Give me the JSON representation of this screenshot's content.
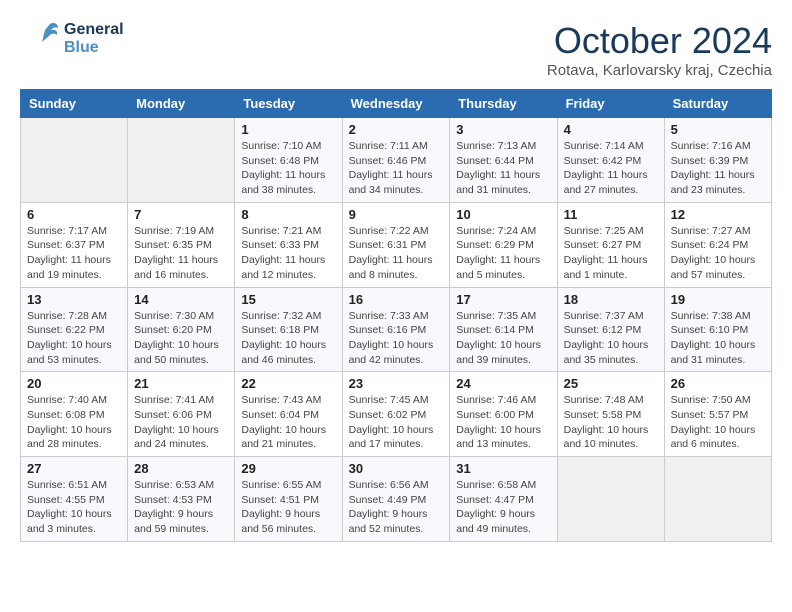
{
  "header": {
    "logo_line1": "General",
    "logo_line2": "Blue",
    "month": "October 2024",
    "location": "Rotava, Karlovarsky kraj, Czechia"
  },
  "days_of_week": [
    "Sunday",
    "Monday",
    "Tuesday",
    "Wednesday",
    "Thursday",
    "Friday",
    "Saturday"
  ],
  "weeks": [
    [
      {
        "day": "",
        "info": ""
      },
      {
        "day": "",
        "info": ""
      },
      {
        "day": "1",
        "info": "Sunrise: 7:10 AM\nSunset: 6:48 PM\nDaylight: 11 hours and 38 minutes."
      },
      {
        "day": "2",
        "info": "Sunrise: 7:11 AM\nSunset: 6:46 PM\nDaylight: 11 hours and 34 minutes."
      },
      {
        "day": "3",
        "info": "Sunrise: 7:13 AM\nSunset: 6:44 PM\nDaylight: 11 hours and 31 minutes."
      },
      {
        "day": "4",
        "info": "Sunrise: 7:14 AM\nSunset: 6:42 PM\nDaylight: 11 hours and 27 minutes."
      },
      {
        "day": "5",
        "info": "Sunrise: 7:16 AM\nSunset: 6:39 PM\nDaylight: 11 hours and 23 minutes."
      }
    ],
    [
      {
        "day": "6",
        "info": "Sunrise: 7:17 AM\nSunset: 6:37 PM\nDaylight: 11 hours and 19 minutes."
      },
      {
        "day": "7",
        "info": "Sunrise: 7:19 AM\nSunset: 6:35 PM\nDaylight: 11 hours and 16 minutes."
      },
      {
        "day": "8",
        "info": "Sunrise: 7:21 AM\nSunset: 6:33 PM\nDaylight: 11 hours and 12 minutes."
      },
      {
        "day": "9",
        "info": "Sunrise: 7:22 AM\nSunset: 6:31 PM\nDaylight: 11 hours and 8 minutes."
      },
      {
        "day": "10",
        "info": "Sunrise: 7:24 AM\nSunset: 6:29 PM\nDaylight: 11 hours and 5 minutes."
      },
      {
        "day": "11",
        "info": "Sunrise: 7:25 AM\nSunset: 6:27 PM\nDaylight: 11 hours and 1 minute."
      },
      {
        "day": "12",
        "info": "Sunrise: 7:27 AM\nSunset: 6:24 PM\nDaylight: 10 hours and 57 minutes."
      }
    ],
    [
      {
        "day": "13",
        "info": "Sunrise: 7:28 AM\nSunset: 6:22 PM\nDaylight: 10 hours and 53 minutes."
      },
      {
        "day": "14",
        "info": "Sunrise: 7:30 AM\nSunset: 6:20 PM\nDaylight: 10 hours and 50 minutes."
      },
      {
        "day": "15",
        "info": "Sunrise: 7:32 AM\nSunset: 6:18 PM\nDaylight: 10 hours and 46 minutes."
      },
      {
        "day": "16",
        "info": "Sunrise: 7:33 AM\nSunset: 6:16 PM\nDaylight: 10 hours and 42 minutes."
      },
      {
        "day": "17",
        "info": "Sunrise: 7:35 AM\nSunset: 6:14 PM\nDaylight: 10 hours and 39 minutes."
      },
      {
        "day": "18",
        "info": "Sunrise: 7:37 AM\nSunset: 6:12 PM\nDaylight: 10 hours and 35 minutes."
      },
      {
        "day": "19",
        "info": "Sunrise: 7:38 AM\nSunset: 6:10 PM\nDaylight: 10 hours and 31 minutes."
      }
    ],
    [
      {
        "day": "20",
        "info": "Sunrise: 7:40 AM\nSunset: 6:08 PM\nDaylight: 10 hours and 28 minutes."
      },
      {
        "day": "21",
        "info": "Sunrise: 7:41 AM\nSunset: 6:06 PM\nDaylight: 10 hours and 24 minutes."
      },
      {
        "day": "22",
        "info": "Sunrise: 7:43 AM\nSunset: 6:04 PM\nDaylight: 10 hours and 21 minutes."
      },
      {
        "day": "23",
        "info": "Sunrise: 7:45 AM\nSunset: 6:02 PM\nDaylight: 10 hours and 17 minutes."
      },
      {
        "day": "24",
        "info": "Sunrise: 7:46 AM\nSunset: 6:00 PM\nDaylight: 10 hours and 13 minutes."
      },
      {
        "day": "25",
        "info": "Sunrise: 7:48 AM\nSunset: 5:58 PM\nDaylight: 10 hours and 10 minutes."
      },
      {
        "day": "26",
        "info": "Sunrise: 7:50 AM\nSunset: 5:57 PM\nDaylight: 10 hours and 6 minutes."
      }
    ],
    [
      {
        "day": "27",
        "info": "Sunrise: 6:51 AM\nSunset: 4:55 PM\nDaylight: 10 hours and 3 minutes."
      },
      {
        "day": "28",
        "info": "Sunrise: 6:53 AM\nSunset: 4:53 PM\nDaylight: 9 hours and 59 minutes."
      },
      {
        "day": "29",
        "info": "Sunrise: 6:55 AM\nSunset: 4:51 PM\nDaylight: 9 hours and 56 minutes."
      },
      {
        "day": "30",
        "info": "Sunrise: 6:56 AM\nSunset: 4:49 PM\nDaylight: 9 hours and 52 minutes."
      },
      {
        "day": "31",
        "info": "Sunrise: 6:58 AM\nSunset: 4:47 PM\nDaylight: 9 hours and 49 minutes."
      },
      {
        "day": "",
        "info": ""
      },
      {
        "day": "",
        "info": ""
      }
    ]
  ]
}
